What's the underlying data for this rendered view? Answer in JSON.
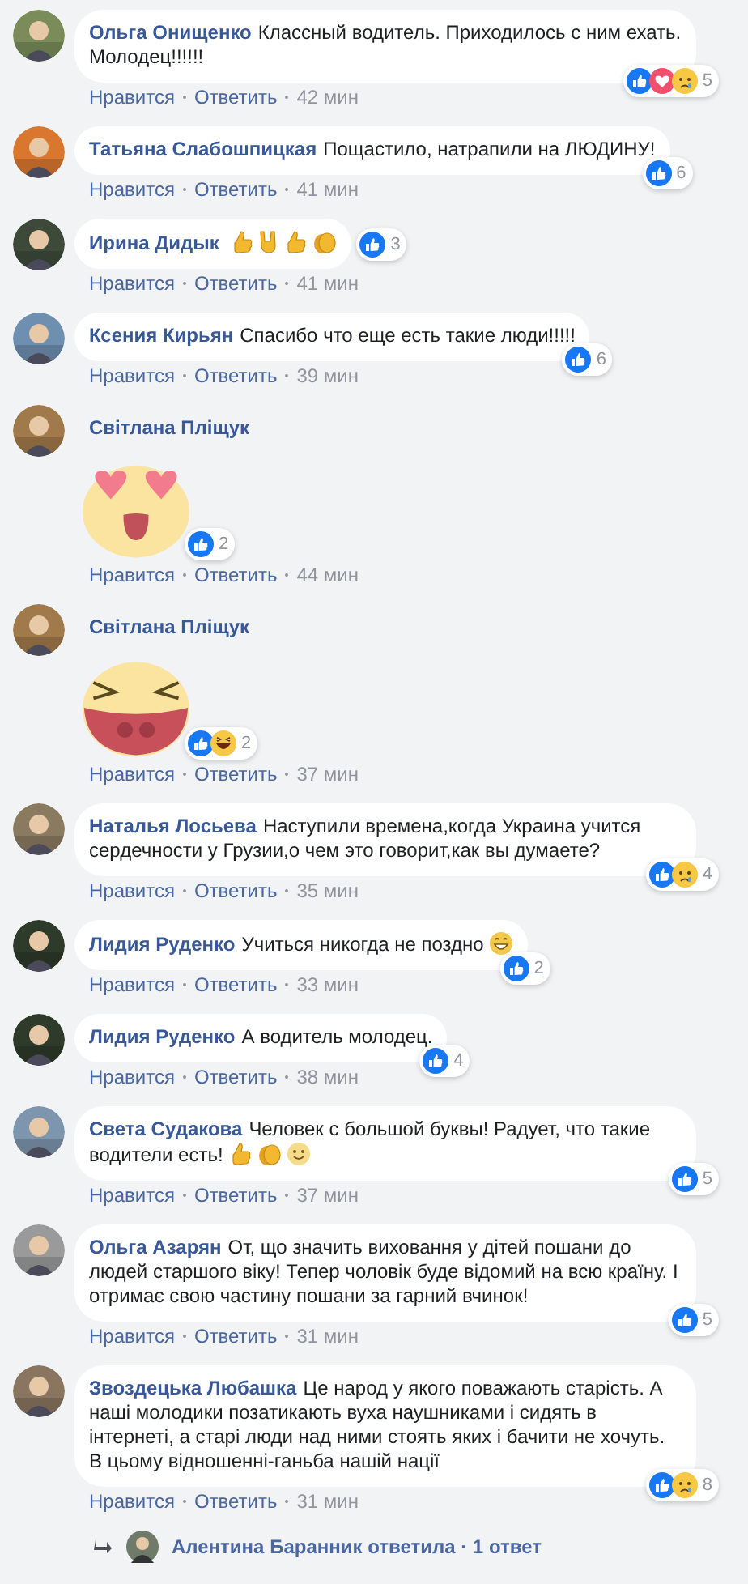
{
  "comments": [
    {
      "kind": "text",
      "author": "Ольга Онищенко",
      "text": "Классный водитель. Приходилось с ним ехать. Молодец!!!!!!",
      "reactions": {
        "icons": [
          {
            "kind": "like"
          },
          {
            "kind": "love"
          },
          {
            "kind": "sad"
          }
        ],
        "count": "5"
      },
      "like_label": "Нравится",
      "reply_label": "Ответить",
      "time": "42 мин"
    },
    {
      "kind": "text",
      "author": "Татьяна Слабошпицкая",
      "text": "Пощастило, натрапили на ЛЮДИНУ!",
      "reactions": {
        "icons": [
          {
            "kind": "like"
          }
        ],
        "count": "6"
      },
      "like_label": "Нравится",
      "reply_label": "Ответить",
      "time": "41 мин"
    },
    {
      "kind": "text",
      "author": "Ирина Дидык",
      "emojis": [
        {
          "kind": "thumb"
        },
        {
          "kind": "horns"
        },
        {
          "kind": "thumb"
        },
        {
          "kind": "clap"
        }
      ],
      "reactions": {
        "icons": [
          {
            "kind": "like"
          }
        ],
        "count": "3"
      },
      "like_label": "Нравится",
      "reply_label": "Ответить",
      "time": "41 мин"
    },
    {
      "kind": "text",
      "author": "Ксения Кирьян",
      "text": "Спасибо что еще есть такие люди!!!!!",
      "reactions": {
        "icons": [
          {
            "kind": "like"
          }
        ],
        "count": "6"
      },
      "like_label": "Нравится",
      "reply_label": "Ответить",
      "time": "39 мин"
    },
    {
      "kind": "sticker",
      "author": "Світлана Пліщук",
      "sticker": {
        "kind": "heart_eyes"
      },
      "reactions": {
        "icons": [
          {
            "kind": "like"
          }
        ],
        "count": "2"
      },
      "like_label": "Нравится",
      "reply_label": "Ответить",
      "time": "44 мин"
    },
    {
      "kind": "sticker",
      "author": "Світлана Пліщук",
      "sticker": {
        "kind": "laughing"
      },
      "reactions": {
        "icons": [
          {
            "kind": "like"
          },
          {
            "kind": "haha"
          }
        ],
        "count": "2"
      },
      "like_label": "Нравится",
      "reply_label": "Ответить",
      "time": "37 мин"
    },
    {
      "kind": "text",
      "author": "Наталья Лосьева",
      "text": "Наступили времена,когда Украина учится сердечности у Грузии,о чем это говорит,как вы думаете?",
      "reactions": {
        "icons": [
          {
            "kind": "like"
          },
          {
            "kind": "sad"
          }
        ],
        "count": "4"
      },
      "like_label": "Нравится",
      "reply_label": "Ответить",
      "time": "35 мин"
    },
    {
      "kind": "text",
      "author": "Лидия Руденко",
      "text": "Учиться никогда не поздно",
      "emojis": [
        {
          "kind": "grin"
        }
      ],
      "reactions": {
        "icons": [
          {
            "kind": "like"
          }
        ],
        "count": "2"
      },
      "like_label": "Нравится",
      "reply_label": "Ответить",
      "time": "33 мин"
    },
    {
      "kind": "text",
      "author": "Лидия Руденко",
      "text": "А водитель молодец.",
      "reactions": {
        "icons": [
          {
            "kind": "like"
          }
        ],
        "count": "4"
      },
      "like_label": "Нравится",
      "reply_label": "Ответить",
      "time": "38 мин"
    },
    {
      "kind": "text",
      "author": "Света Судакова",
      "text": "Человек с большой буквы! Радует, что такие водители есть!",
      "emojis": [
        {
          "kind": "thumb"
        },
        {
          "kind": "clap"
        },
        {
          "kind": "smile"
        }
      ],
      "reactions": {
        "icons": [
          {
            "kind": "like"
          }
        ],
        "count": "5"
      },
      "like_label": "Нравится",
      "reply_label": "Ответить",
      "time": "37 мин"
    },
    {
      "kind": "text",
      "author": "Ольга Азарян",
      "text": "От, що значить виховання у дітей пошани до людей старшого віку! Тепер чоловік буде відомий на всю країну. І отримає свою частину пошани за гарний вчинок!",
      "reactions": {
        "icons": [
          {
            "kind": "like"
          }
        ],
        "count": "5"
      },
      "like_label": "Нравится",
      "reply_label": "Ответить",
      "time": "31 мин"
    },
    {
      "kind": "text",
      "author": "Звоздецька Любашка",
      "text": "Це народ у якого поважають старість. А наші молодики позатикають вуха наушниками і сидять в інтернеті, а старі люди над ними стоять яких і бачити не хочуть. В цьому відношенні-ганьба нашій нації",
      "reactions": {
        "icons": [
          {
            "kind": "like"
          },
          {
            "kind": "sad"
          }
        ],
        "count": "8"
      },
      "like_label": "Нравится",
      "reply_label": "Ответить",
      "time": "31 мин"
    }
  ],
  "reply_summary": {
    "text": "Алентина Баранник ответила · 1 ответ"
  }
}
